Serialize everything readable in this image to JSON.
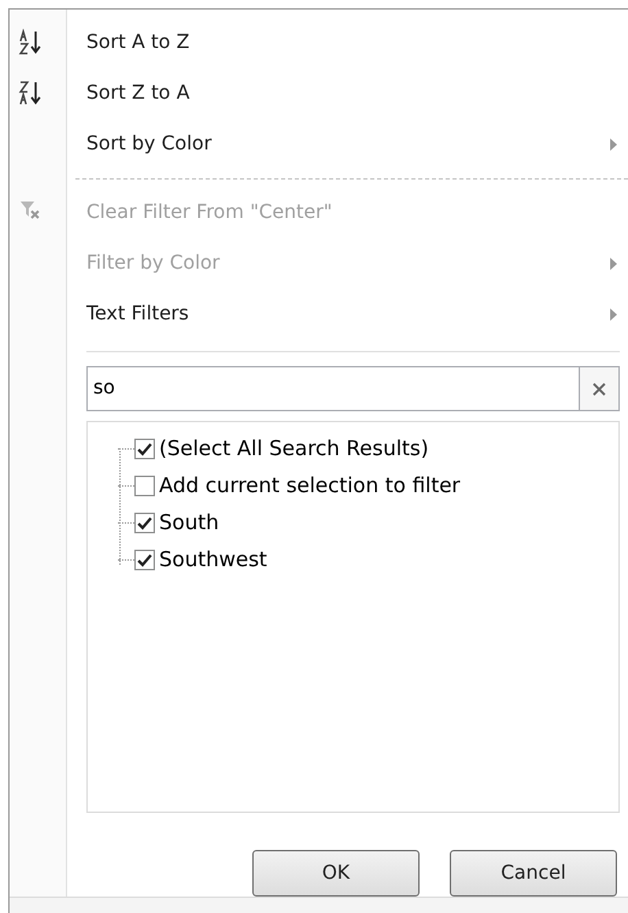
{
  "menu": [
    {
      "kind": "sort-ascending",
      "label": "Sort A to Z",
      "disabled": false,
      "submenu": false
    },
    {
      "kind": "sort-descending",
      "label": "Sort Z to A",
      "disabled": false,
      "submenu": false
    },
    {
      "kind": "plain",
      "label": "Sort by Color",
      "disabled": false,
      "submenu": true
    },
    {
      "kind": "separator"
    },
    {
      "kind": "clear-filter",
      "label": "Clear Filter From \"Center\"",
      "disabled": true,
      "submenu": false
    },
    {
      "kind": "plain",
      "label": "Filter by Color",
      "disabled": true,
      "submenu": true
    },
    {
      "kind": "plain",
      "label": "Text Filters",
      "disabled": false,
      "submenu": true
    }
  ],
  "search": {
    "value": "so"
  },
  "list": [
    {
      "label": "(Select All Search Results)",
      "checked": true
    },
    {
      "label": "Add current selection to filter",
      "checked": false
    },
    {
      "label": "South",
      "checked": true
    },
    {
      "label": "Southwest",
      "checked": true
    }
  ],
  "buttons": [
    "OK",
    "Cancel"
  ]
}
